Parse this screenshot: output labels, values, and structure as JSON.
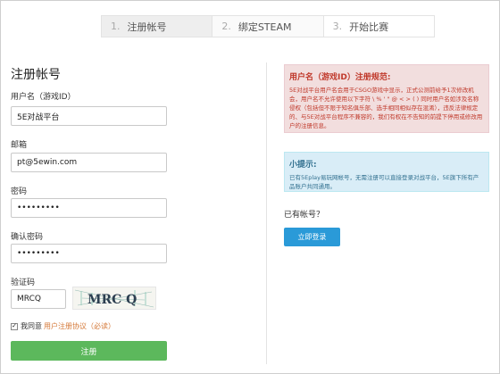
{
  "steps": [
    {
      "num": "1.",
      "label": "注册帐号"
    },
    {
      "num": "2.",
      "label": "绑定STEAM"
    },
    {
      "num": "3.",
      "label": "开始比赛"
    }
  ],
  "form": {
    "title": "注册帐号",
    "username_label": "用户名（游戏ID）",
    "username_value": "5E对战平台",
    "email_label": "邮箱",
    "email_value": "pt@5ewin.com",
    "password_label": "密码",
    "password_value": "•••••••••",
    "confirm_label": "确认密码",
    "confirm_value": "•••••••••",
    "captcha_label": "验证码",
    "captcha_value": "MRCQ",
    "captcha_image_text": "MRC Q",
    "agree_checkbox": "✓",
    "agree_text": "我同意",
    "agree_link": "用户注册协议（必读）",
    "submit_label": "注册"
  },
  "notice": {
    "title": "用户名（游戏ID）注册规范:",
    "body": "5E对战平台用户名会用于CSGO游戏中显示，正式公测前给予1次修改机会，用户名不允许使用以下字符 \\ % ' \" @ < > ( ) 同时用户名如涉及名称侵权（包括但不限于知名俱乐部、选手相同相似存在混淆），违反法律规定的、与5E对战平台程序不兼容的，我们有权在不告知的前提下停用或修改用户的注册信息。"
  },
  "tip": {
    "title": "小提示:",
    "body": "已有5Eplay易玩网帐号，无需注册可以直接登录对战平台，5E旗下所有产品账户共同通用。"
  },
  "account": {
    "has_account": "已有帐号？",
    "login_label": "立即登录"
  },
  "colors": {
    "submit": "#5cb85c",
    "login": "#2a9ad8",
    "notice_bg": "#f2dede",
    "notice_text": "#c0392b",
    "tip_bg": "#d9edf7",
    "tip_text": "#31708f"
  }
}
